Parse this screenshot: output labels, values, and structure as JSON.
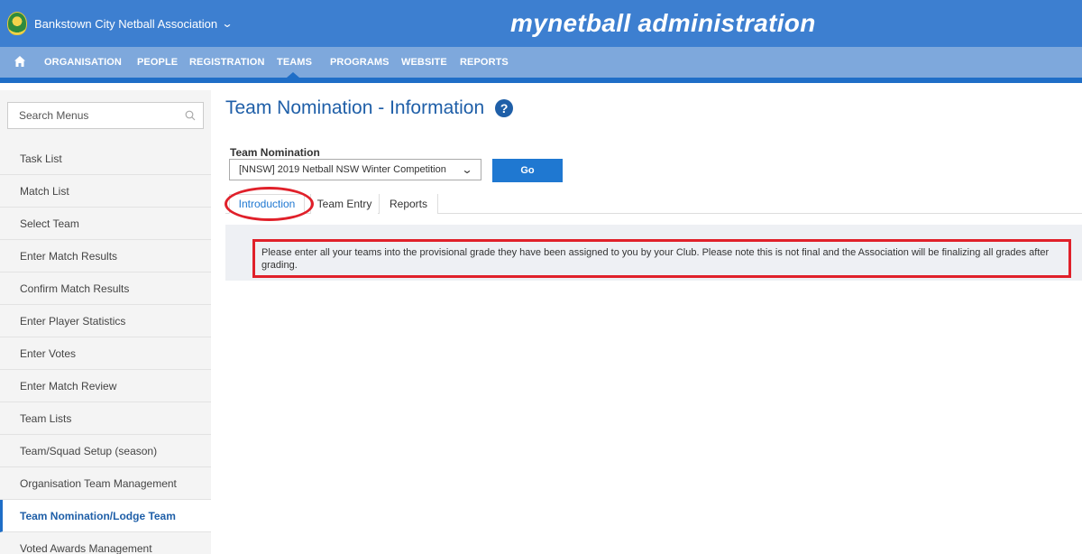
{
  "header": {
    "org_name": "Bankstown City Netball Association",
    "app_title": "mynetball administration",
    "brand_color": "#3d7fd0"
  },
  "nav": {
    "home_icon": "home-icon",
    "items": [
      "ORGANISATION",
      "PEOPLE",
      "REGISTRATION",
      "TEAMS",
      "PROGRAMS",
      "WEBSITE",
      "REPORTS"
    ],
    "active": "TEAMS"
  },
  "sidebar": {
    "search_placeholder": "Search Menus",
    "items": [
      {
        "label": "Task List"
      },
      {
        "label": "Match List"
      },
      {
        "label": "Select Team"
      },
      {
        "label": "Enter Match Results"
      },
      {
        "label": "Confirm Match Results"
      },
      {
        "label": "Enter Player Statistics"
      },
      {
        "label": "Enter Votes"
      },
      {
        "label": "Enter Match Review"
      },
      {
        "label": "Team Lists"
      },
      {
        "label": "Team/Squad Setup (season)"
      },
      {
        "label": "Organisation Team Management"
      },
      {
        "label": "Team Nomination/Lodge Team"
      },
      {
        "label": "Voted Awards Management"
      }
    ],
    "active_item": "Team Nomination/Lodge Team"
  },
  "main": {
    "title": "Team Nomination - Information",
    "field_label": "Team Nomination",
    "selected_nomination": "[NNSW] 2019 Netball NSW Winter Competition",
    "go_label": "Go",
    "tabs": [
      {
        "label": "Introduction"
      },
      {
        "label": "Team Entry"
      },
      {
        "label": "Reports"
      }
    ],
    "active_tab": "Introduction",
    "info_text": "Please enter all your teams into the provisional grade they have been assigned to you by your Club. Please note this is not final and the Association will be finalizing all grades after grading."
  },
  "annotation_color": "#e0202a"
}
